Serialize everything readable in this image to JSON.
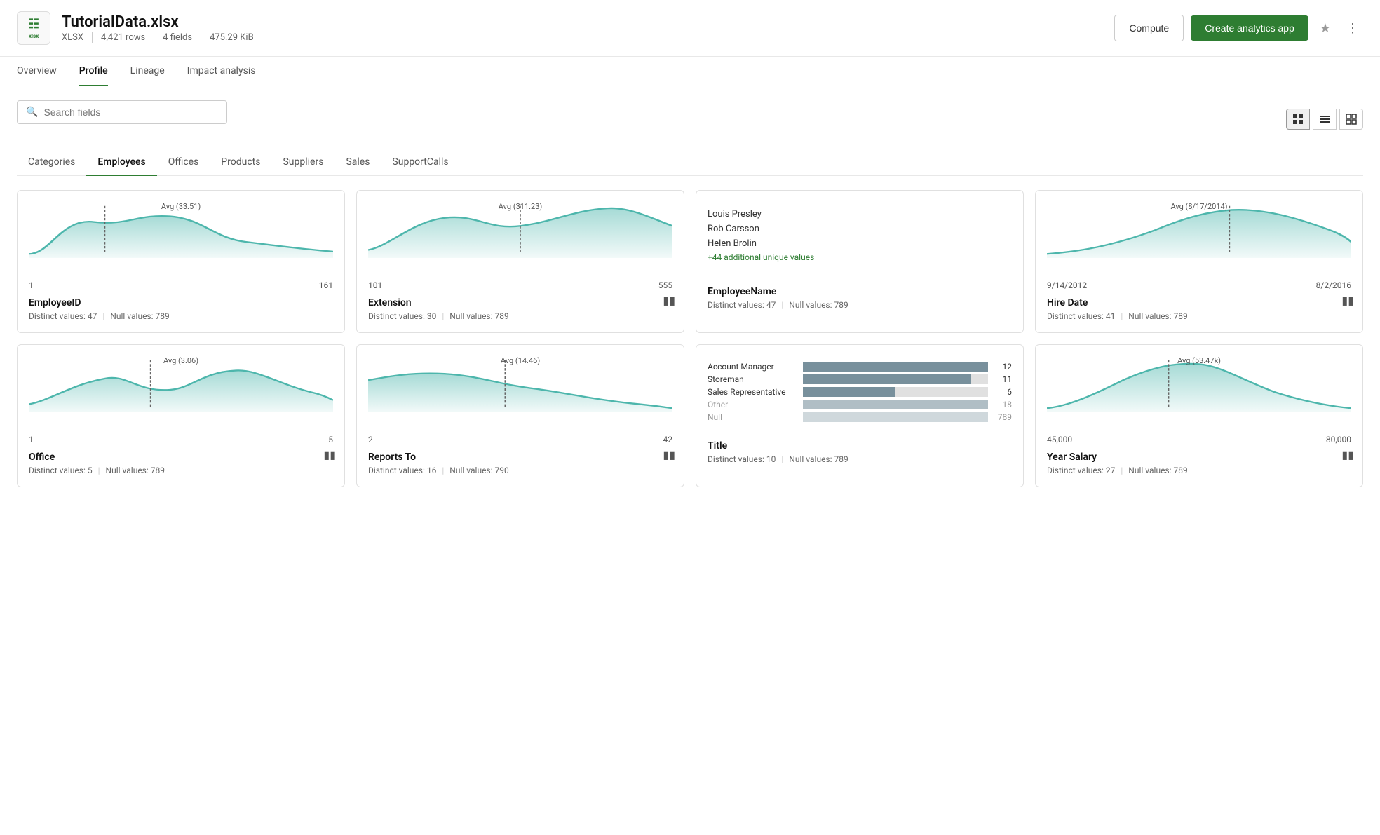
{
  "header": {
    "file_icon_text": "xlsx",
    "file_title": "TutorialData.xlsx",
    "file_type": "XLSX",
    "file_rows": "4,421 rows",
    "file_fields": "4 fields",
    "file_size": "475.29 KiB",
    "btn_compute": "Compute",
    "btn_create": "Create analytics app"
  },
  "nav_tabs": [
    {
      "label": "Overview",
      "active": false
    },
    {
      "label": "Profile",
      "active": true
    },
    {
      "label": "Lineage",
      "active": false
    },
    {
      "label": "Impact analysis",
      "active": false
    }
  ],
  "search": {
    "placeholder": "Search fields"
  },
  "view_icons": [
    "grid",
    "list",
    "table"
  ],
  "category_tabs": [
    {
      "label": "Categories",
      "active": false
    },
    {
      "label": "Employees",
      "active": true
    },
    {
      "label": "Offices",
      "active": false
    },
    {
      "label": "Products",
      "active": false
    },
    {
      "label": "Suppliers",
      "active": false
    },
    {
      "label": "Sales",
      "active": false
    },
    {
      "label": "SupportCalls",
      "active": false
    }
  ],
  "cards": [
    {
      "id": "employee-id",
      "type": "sparkline",
      "avg_label": "Avg (33.51)",
      "avg_x_pct": 25,
      "range_min": "1",
      "range_max": "161",
      "field_name": "EmployeeID",
      "distinct": "47",
      "nulls": "789",
      "has_bar_icon": false,
      "curve": "hump-left"
    },
    {
      "id": "extension",
      "type": "sparkline",
      "avg_label": "Avg (311.23)",
      "avg_x_pct": 50,
      "range_min": "101",
      "range_max": "555",
      "field_name": "Extension",
      "distinct": "30",
      "nulls": "789",
      "has_bar_icon": true,
      "curve": "double-hump"
    },
    {
      "id": "employee-name",
      "type": "text",
      "values": [
        "Louis Presley",
        "Rob Carsson",
        "Helen Brolin"
      ],
      "extra_text": "+44 additional unique values",
      "field_name": "EmployeeName",
      "distinct": "47",
      "nulls": "789",
      "has_bar_icon": false
    },
    {
      "id": "hire-date",
      "type": "sparkline",
      "avg_label": "Avg (8/17/2014)",
      "avg_x_pct": 60,
      "range_min": "9/14/2012",
      "range_max": "8/2/2016",
      "field_name": "Hire Date",
      "distinct": "41",
      "nulls": "789",
      "has_bar_icon": true,
      "curve": "hump-right"
    },
    {
      "id": "office",
      "type": "sparkline",
      "avg_label": "Avg (3.06)",
      "avg_x_pct": 40,
      "range_min": "1",
      "range_max": "5",
      "field_name": "Office",
      "distinct": "5",
      "nulls": "789",
      "has_bar_icon": true,
      "curve": "multi-hump"
    },
    {
      "id": "reports-to",
      "type": "sparkline",
      "avg_label": "Avg (14.46)",
      "avg_x_pct": 45,
      "range_min": "2",
      "range_max": "42",
      "field_name": "Reports To",
      "distinct": "16",
      "nulls": "790",
      "has_bar_icon": true,
      "curve": "hump-left-shallow"
    },
    {
      "id": "title",
      "type": "bar",
      "bars": [
        {
          "label": "Account Manager",
          "value": 12,
          "max": 12,
          "muted": false
        },
        {
          "label": "Storeman",
          "value": 11,
          "max": 12,
          "muted": false
        },
        {
          "label": "Sales Representative",
          "value": 6,
          "max": 12,
          "muted": false
        },
        {
          "label": "Other",
          "value": 18,
          "max": 18,
          "muted": true
        },
        {
          "label": "Null",
          "value": 789,
          "max": 789,
          "muted": true
        }
      ],
      "field_name": "Title",
      "distinct": "10",
      "nulls": "789",
      "has_bar_icon": false
    },
    {
      "id": "year-salary",
      "type": "sparkline",
      "avg_label": "Avg (53.47k)",
      "avg_x_pct": 40,
      "range_min": "45,000",
      "range_max": "80,000",
      "field_name": "Year Salary",
      "distinct": "27",
      "nulls": "789",
      "has_bar_icon": true,
      "curve": "hump-center"
    }
  ]
}
